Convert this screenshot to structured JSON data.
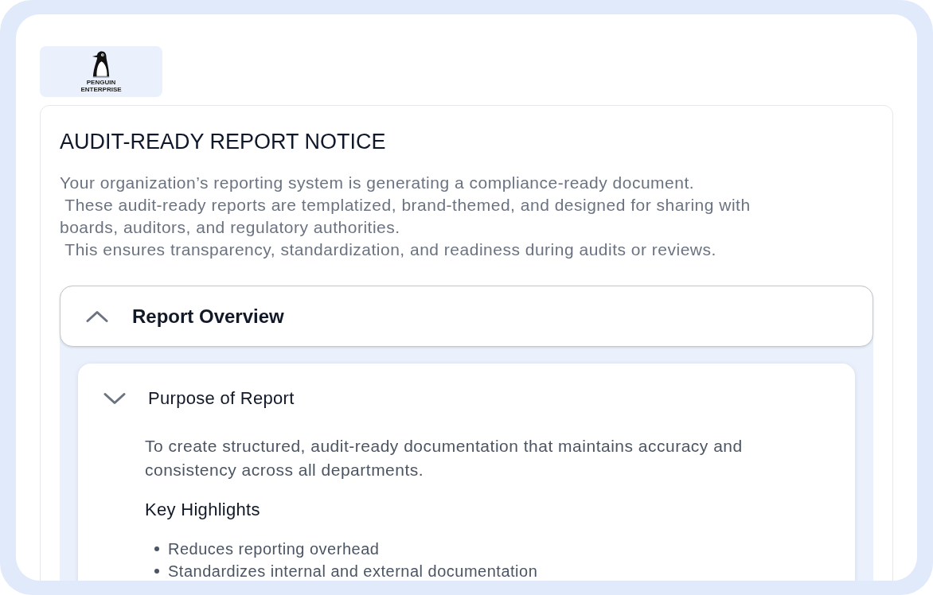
{
  "logo": {
    "lines": [
      "PENGUIN",
      "ENTERPRISE"
    ]
  },
  "notice": {
    "title": "AUDIT-READY REPORT NOTICE",
    "description": "Your organization’s reporting system is generating a compliance-ready document.\n These audit-ready reports are templatized, brand-themed, and designed for sharing with boards, auditors, and regulatory authorities.\n This ensures transparency, standardization, and readiness during audits or reviews."
  },
  "accordion": {
    "title": "Report Overview",
    "expanded": true,
    "sections": [
      {
        "title": "Purpose of Report",
        "expanded": true,
        "description": "To create structured, audit-ready documentation that maintains accuracy and consistency across all departments.",
        "subheading": "Key Highlights",
        "highlights": [
          "Reduces reporting overhead",
          "Standardizes internal and external documentation"
        ]
      }
    ]
  }
}
